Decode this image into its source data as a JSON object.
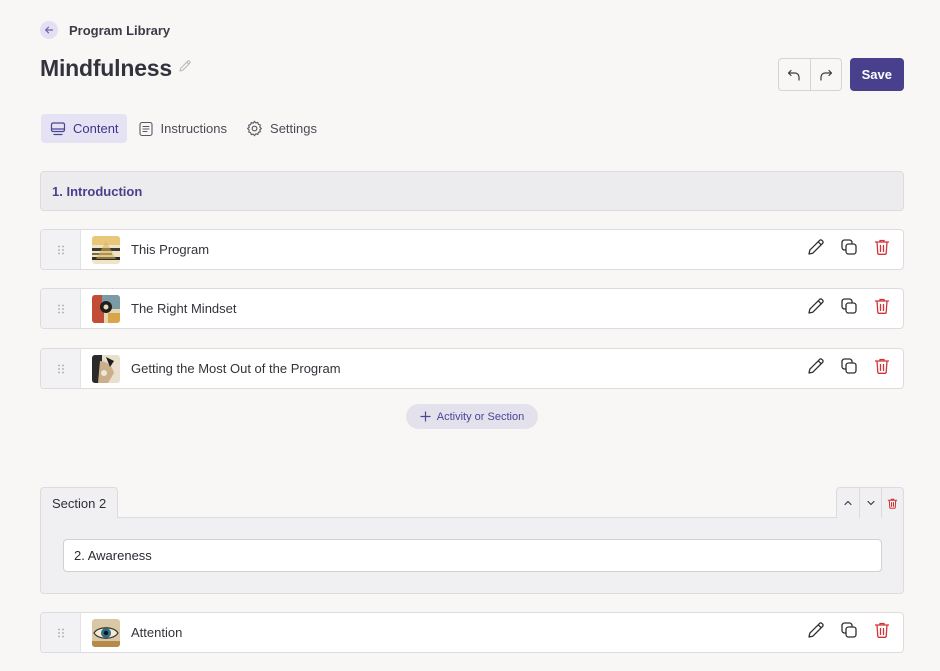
{
  "breadcrumb": {
    "back_label": "Program Library"
  },
  "page": {
    "title": "Mindfulness"
  },
  "toolbar": {
    "save_label": "Save"
  },
  "tabs": [
    {
      "label": "Content",
      "icon": "monitor-icon",
      "active": true
    },
    {
      "label": "Instructions",
      "icon": "document-icon",
      "active": false
    },
    {
      "label": "Settings",
      "icon": "gear-icon",
      "active": false
    }
  ],
  "sections": [
    {
      "title": "1. Introduction",
      "activities": [
        {
          "label": "This Program"
        },
        {
          "label": "The Right Mindset"
        },
        {
          "label": "Getting the Most Out of the Program"
        }
      ],
      "add_label": "Activity or Section"
    },
    {
      "tab_label": "Section 2",
      "title_value": "2. Awareness",
      "activities": [
        {
          "label": "Attention"
        }
      ]
    }
  ],
  "colors": {
    "accent": "#48408c",
    "danger": "#d13438",
    "background": "#f8f7f5"
  }
}
